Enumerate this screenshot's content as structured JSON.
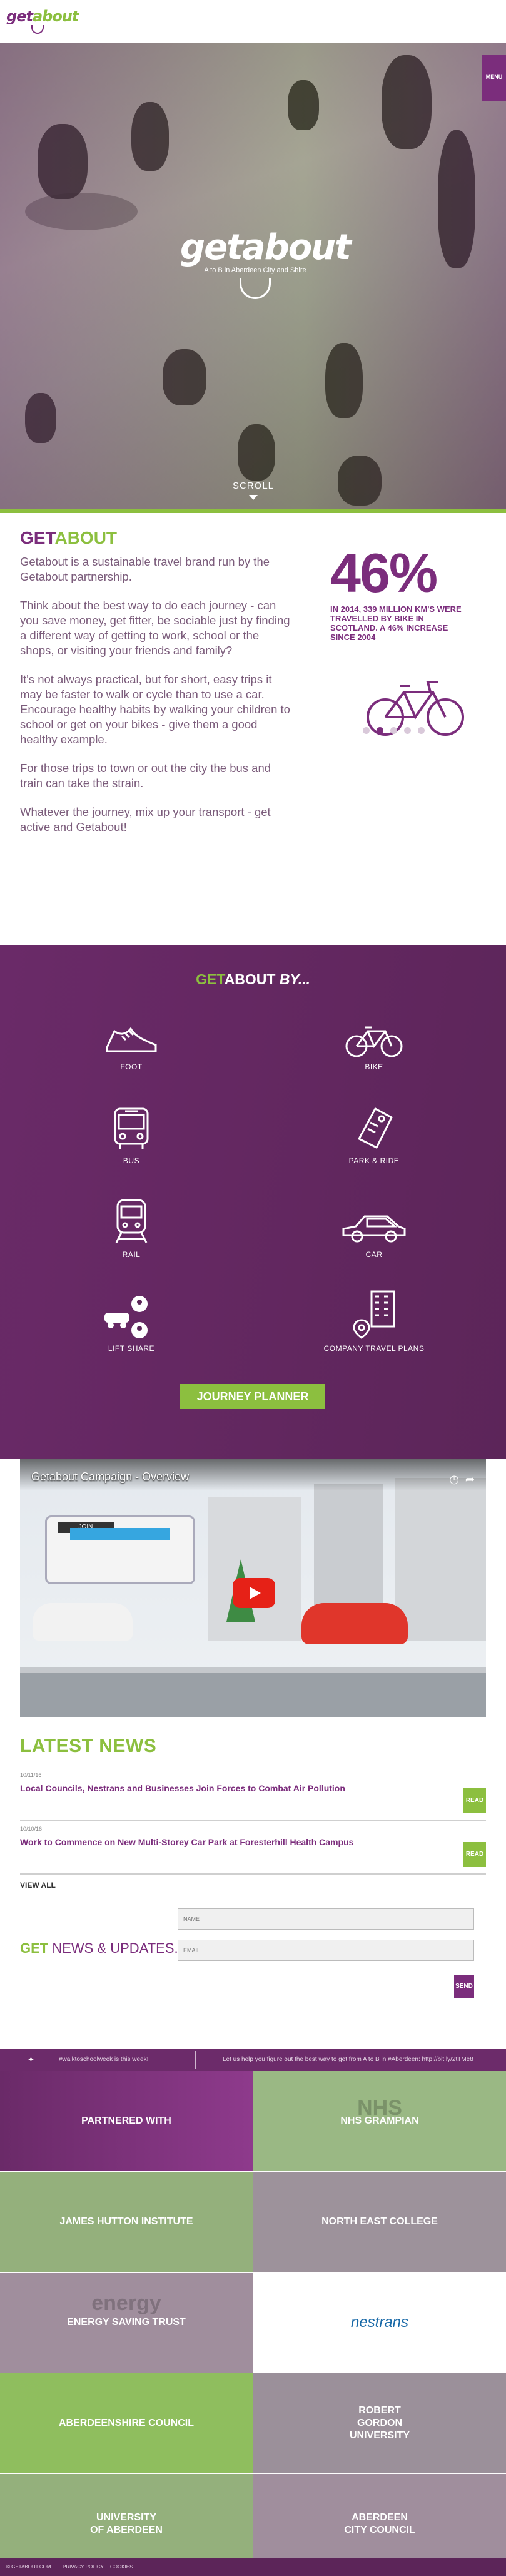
{
  "header": {
    "logo_main": "getabout",
    "logo_alt": "getabout logo"
  },
  "hero": {
    "logo_text": "getabout",
    "tagline": "A to B in Aberdeen City and Shire",
    "menu_label": "MENU",
    "scroll_label": "SCROLL"
  },
  "about": {
    "title_a": "GET",
    "title_b": "ABOUT",
    "paragraphs": [
      "Getabout is a sustainable travel brand run by the Getabout partnership.",
      "Think about the best way to do each journey - can you save money, get fitter, be sociable just by finding a different way of getting to work, school or the shops, or visiting your friends and family?",
      "It's not always practical, but for short, easy trips it may be faster to walk or cycle than to use a car. Encourage healthy habits by walking your children to school or get on your bikes - give them a good healthy example.",
      "For those trips to town or out the city the bus and train can take the strain.",
      "Whatever the journey, mix up your transport - get active and Getabout!"
    ],
    "stat_number": "46%",
    "stat_text": "IN 2014, 339 MILLION KM'S WERE TRAVELLED BY BIKE IN SCOTLAND. A 46% INCREASE SINCE 2004",
    "carousel_active": 2,
    "carousel_count": 5
  },
  "modes": {
    "heading_a": "GET",
    "heading_b": "ABOUT",
    "heading_c": " BY...",
    "items": [
      {
        "label": "FOOT",
        "icon": "shoe-icon"
      },
      {
        "label": "BIKE",
        "icon": "bike-icon"
      },
      {
        "label": "BUS",
        "icon": "bus-icon"
      },
      {
        "label": "PARK & RIDE",
        "icon": "park-ride-icon"
      },
      {
        "label": "RAIL",
        "icon": "train-icon"
      },
      {
        "label": "CAR",
        "icon": "car-icon"
      },
      {
        "label": "LIFT SHARE",
        "icon": "lift-share-icon"
      },
      {
        "label": "COMPANY TRAVEL PLANS",
        "icon": "company-building-icon"
      }
    ],
    "planner_label": "JOURNEY PLANNER"
  },
  "video": {
    "title": "Getabout Campaign - Overview",
    "bus_sign": "JOIN"
  },
  "news": {
    "heading": "LATEST NEWS",
    "items": [
      {
        "date": "10/11/16",
        "title": "Local Councils, Nestrans and Businesses Join Forces to Combat Air Pollution",
        "read": "READ"
      },
      {
        "date": "10/10/16",
        "title": "Work to Commence on New Multi-Storey Car Park at Foresterhill Health Campus",
        "read": "READ"
      }
    ],
    "view_all": "VIEW ALL",
    "updates_a": "GET",
    "updates_b": " NEWS & UPDATES...",
    "name_placeholder": "NAME",
    "email_placeholder": "EMAIL",
    "send": "SEND"
  },
  "tweets": {
    "tweet1": "#walktoschoolweek is this week!",
    "tweet2": "Let us help you figure out the best way to get from A to B in #Aberdeen: http://bit.ly/2tTMe8"
  },
  "partners": {
    "tiles": [
      {
        "label": "PARTNERED WITH",
        "ghost": "",
        "bg": "#7b2d7c"
      },
      {
        "label": "NHS GRAMPIAN",
        "ghost": "NHS",
        "bg": "#98b880"
      },
      {
        "label": "JAMES HUTTON INSTITUTE",
        "ghost": "",
        "bg": "#93b07a"
      },
      {
        "label": "NORTH EAST COLLEGE",
        "ghost": "",
        "bg": "#9c919a"
      },
      {
        "label": "ENERGY SAVING TRUST",
        "ghost": "energy",
        "bg": "#a08e9d"
      },
      {
        "label": "nestrans",
        "ghost": "",
        "bg": "#ffffff"
      },
      {
        "label": "ABERDEENSHIRE COUNCIL",
        "ghost": "",
        "bg": "#8fbf5c"
      },
      {
        "label": "ROBERT GORDON UNIVERSITY",
        "ghost": "",
        "bg": "#9b909a"
      },
      {
        "label": "UNIVERSITY OF ABERDEEN",
        "ghost": "",
        "bg": "#93b07a"
      },
      {
        "label": "ABERDEEN CITY COUNCIL",
        "ghost": "",
        "bg": "#a08e9d"
      }
    ]
  },
  "footer": {
    "copyright": "© GETABOUT.COM",
    "privacy": "PRIVACY POLICY",
    "cookies": "COOKIES"
  },
  "colors": {
    "purple": "#7b2d7c",
    "green": "#8cbf3f"
  }
}
